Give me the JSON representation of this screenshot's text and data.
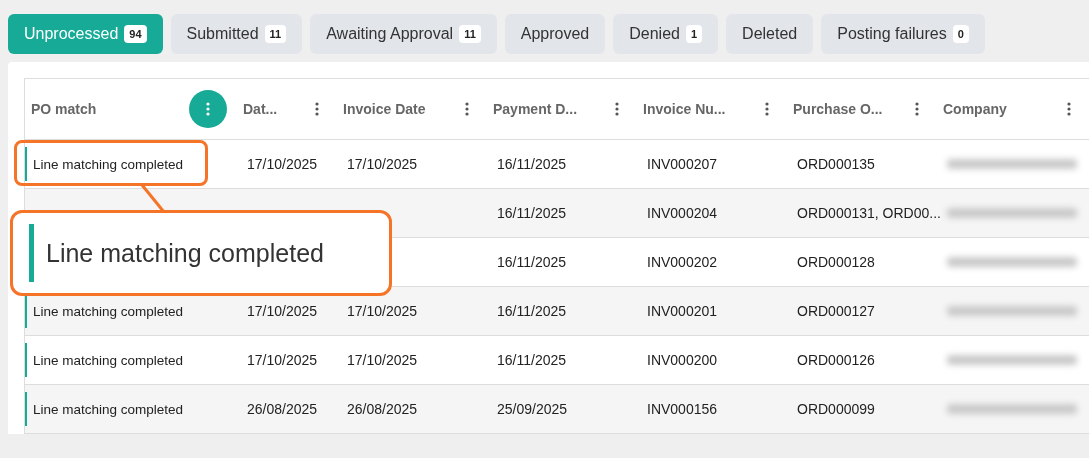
{
  "tabs": [
    {
      "label": "Unprocessed",
      "count": "94",
      "selected": true
    },
    {
      "label": "Submitted",
      "count": "11",
      "selected": false
    },
    {
      "label": "Awaiting Approval",
      "count": "11",
      "selected": false
    },
    {
      "label": "Approved",
      "selected": false
    },
    {
      "label": "Denied",
      "count": "1",
      "selected": false
    },
    {
      "label": "Deleted",
      "selected": false
    },
    {
      "label": "Posting failures",
      "count": "0",
      "selected": false
    }
  ],
  "table": {
    "columns": [
      {
        "label": "PO match",
        "active": true
      },
      {
        "label": "Dat...",
        "active": false
      },
      {
        "label": "Invoice Date",
        "active": false
      },
      {
        "label": "Payment D...",
        "active": false
      },
      {
        "label": "Invoice Nu...",
        "active": false
      },
      {
        "label": "Purchase O...",
        "active": false
      },
      {
        "label": "Company",
        "active": false
      }
    ],
    "rows": [
      {
        "po_match": "Line matching completed",
        "date": "17/10/2025",
        "invoice_date": "17/10/2025",
        "payment_date": "16/11/2025",
        "invoice_number": "INV000207",
        "purchase_order": "ORD000135"
      },
      {
        "payment_date": "16/11/2025",
        "invoice_number": "INV000204",
        "purchase_order": "ORD000131, ORD00..."
      },
      {
        "payment_date": "16/11/2025",
        "invoice_number": "INV000202",
        "purchase_order": "ORD000128"
      },
      {
        "po_match": "Line matching completed",
        "date": "17/10/2025",
        "invoice_date": "17/10/2025",
        "payment_date": "16/11/2025",
        "invoice_number": "INV000201",
        "purchase_order": "ORD000127"
      },
      {
        "po_match": "Line matching completed",
        "date": "17/10/2025",
        "invoice_date": "17/10/2025",
        "payment_date": "16/11/2025",
        "invoice_number": "INV000200",
        "purchase_order": "ORD000126"
      },
      {
        "po_match": "Line matching completed",
        "date": "26/08/2025",
        "invoice_date": "26/08/2025",
        "payment_date": "25/09/2025",
        "invoice_number": "INV000156",
        "purchase_order": "ORD000099"
      }
    ]
  },
  "callout": {
    "text": "Line matching completed"
  }
}
